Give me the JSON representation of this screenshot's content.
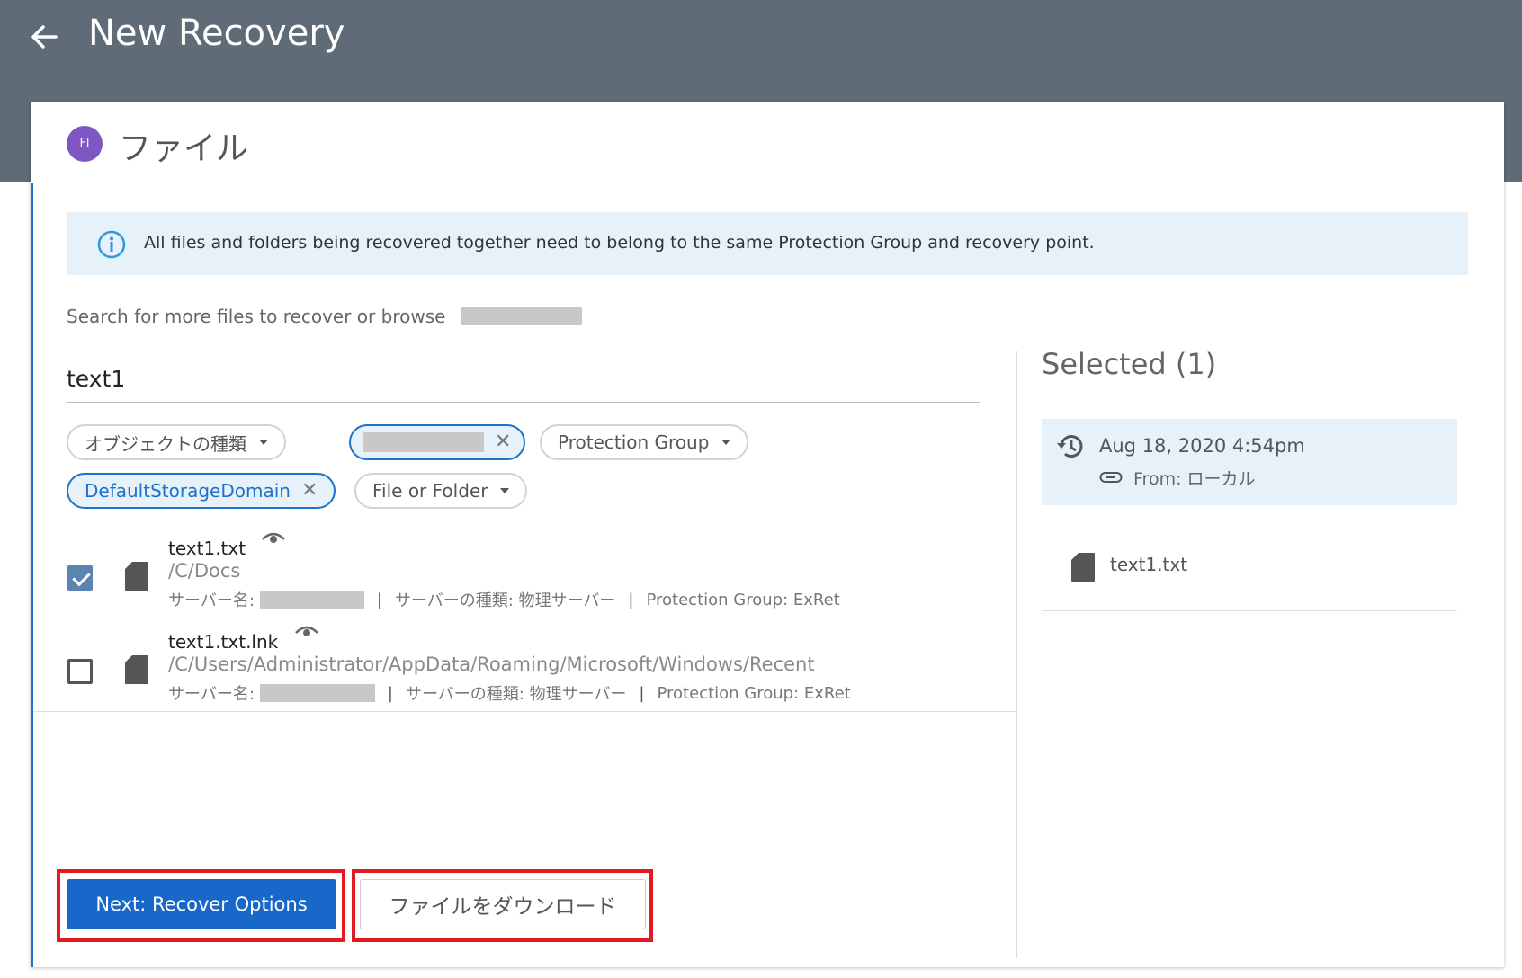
{
  "header": {
    "title": "New Recovery",
    "back_icon": "arrow-left-icon"
  },
  "card": {
    "avatar_text": "Fl",
    "avatar_color": "#7e57c2",
    "title": "ファイル"
  },
  "info_banner": {
    "icon": "info-icon",
    "text": "All files and folders being recovered together need to belong to the same Protection Group and recovery point."
  },
  "search": {
    "browse_text": "Search for more files to recover or browse",
    "query": "text1"
  },
  "filters": {
    "object_type": "オブジェクトの種類",
    "protection_group": "Protection Group",
    "storage_domain": "DefaultStorageDomain",
    "file_or_folder": "File or Folder"
  },
  "results": [
    {
      "name": "text1.txt",
      "path": "/C/Docs",
      "checked": true,
      "server_label": "サーバー名:",
      "server_type": "サーバーの種類:  物理サーバー",
      "protection_group": "Protection Group:  ExRet"
    },
    {
      "name": "text1.txt.lnk",
      "path": "/C/Users/Administrator/AppData/Roaming/Microsoft/Windows/Recent",
      "checked": false,
      "server_label": "サーバー名:",
      "server_type": "サーバーの種類:  物理サーバー",
      "protection_group": "Protection Group:  ExRet"
    }
  ],
  "selected": {
    "title": "Selected (1)",
    "recovery_point_date": "Aug 18, 2020 4:54pm",
    "recovery_point_from": "From: ローカル",
    "items": [
      "text1.txt"
    ]
  },
  "actions": {
    "next_label": "Next: Recover Options",
    "download_label": "ファイルをダウンロード"
  },
  "colors": {
    "header_bg": "#5f6b77",
    "accent": "#1d73c9",
    "primary_button": "#1868c9",
    "highlight": "#e01b24",
    "banner_bg": "#e6f1fa"
  }
}
